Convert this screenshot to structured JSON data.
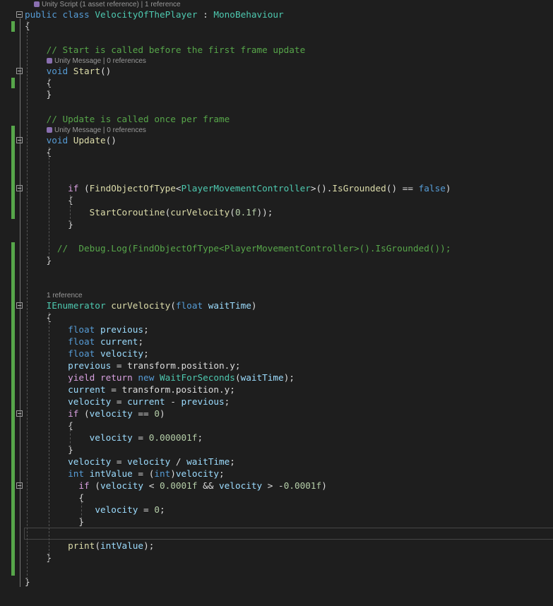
{
  "editor": {
    "colors": {
      "keyword": "#569cd6",
      "type": "#4ec9b0",
      "method": "#dcdcaa",
      "variable": "#9cdcfe",
      "comment": "#57a64a",
      "number": "#b5cea8",
      "control": "#d8a0df",
      "change_bar": "#57a64a"
    },
    "codelens_icon": "unity-cube-icon",
    "lines": [
      {
        "lens": "Unity Script (1 asset reference) | 1 reference",
        "icon": true
      },
      {
        "t": [
          [
            "kw",
            "public"
          ],
          [
            "pl",
            " "
          ],
          [
            "kw",
            "class"
          ],
          [
            "pl",
            " "
          ],
          [
            "ty",
            "VelocityOfThePlayer"
          ],
          [
            "pl",
            " : "
          ],
          [
            "ty",
            "MonoBehaviour"
          ]
        ]
      },
      {
        "t": [
          [
            "pl",
            "{"
          ]
        ]
      },
      {
        "t": []
      },
      {
        "t": [
          [
            "pl",
            "    "
          ],
          [
            "cm",
            "// Start is called before the first frame update"
          ]
        ]
      },
      {
        "lens": "Unity Message | 0 references",
        "icon": true
      },
      {
        "t": [
          [
            "pl",
            "    "
          ],
          [
            "kw",
            "void"
          ],
          [
            "pl",
            " "
          ],
          [
            "fn",
            "Start"
          ],
          [
            "pl",
            "()"
          ]
        ]
      },
      {
        "t": [
          [
            "pl",
            "    {"
          ]
        ]
      },
      {
        "t": [
          [
            "pl",
            "    }"
          ]
        ]
      },
      {
        "t": []
      },
      {
        "t": [
          [
            "pl",
            "    "
          ],
          [
            "cm",
            "// Update is called once per frame"
          ]
        ]
      },
      {
        "lens": "Unity Message | 0 references",
        "icon": true
      },
      {
        "t": [
          [
            "pl",
            "    "
          ],
          [
            "kw",
            "void"
          ],
          [
            "pl",
            " "
          ],
          [
            "fn",
            "Update"
          ],
          [
            "pl",
            "()"
          ]
        ]
      },
      {
        "t": [
          [
            "pl",
            "    {"
          ]
        ]
      },
      {
        "t": []
      },
      {
        "t": []
      },
      {
        "t": [
          [
            "pl",
            "        "
          ],
          [
            "ctl",
            "if"
          ],
          [
            "pl",
            " ("
          ],
          [
            "fn",
            "FindObjectOfType"
          ],
          [
            "pl",
            "<"
          ],
          [
            "ty",
            "PlayerMovementController"
          ],
          [
            "pl",
            ">()."
          ],
          [
            "fn",
            "IsGrounded"
          ],
          [
            "pl",
            "() == "
          ],
          [
            "kw",
            "false"
          ],
          [
            "pl",
            ")"
          ]
        ]
      },
      {
        "t": [
          [
            "pl",
            "        {"
          ]
        ]
      },
      {
        "t": [
          [
            "pl",
            "            "
          ],
          [
            "fn",
            "StartCoroutine"
          ],
          [
            "pl",
            "("
          ],
          [
            "fn",
            "curVelocity"
          ],
          [
            "pl",
            "("
          ],
          [
            "nu",
            "0.1f"
          ],
          [
            "pl",
            "));"
          ]
        ]
      },
      {
        "t": [
          [
            "pl",
            "        }"
          ]
        ]
      },
      {
        "t": []
      },
      {
        "t": [
          [
            "pl",
            "      "
          ],
          [
            "cm",
            "//  Debug.Log(FindObjectOfType<PlayerMovementController>().IsGrounded());"
          ]
        ]
      },
      {
        "t": [
          [
            "pl",
            "    }"
          ]
        ]
      },
      {
        "t": []
      },
      {
        "t": []
      },
      {
        "lens": "1 reference",
        "icon": false
      },
      {
        "t": [
          [
            "pl",
            "    "
          ],
          [
            "ty",
            "IEnumerator"
          ],
          [
            "pl",
            " "
          ],
          [
            "fn",
            "curVelocity"
          ],
          [
            "pl",
            "("
          ],
          [
            "kw",
            "float"
          ],
          [
            "pl",
            " "
          ],
          [
            "va",
            "waitTime"
          ],
          [
            "pl",
            ")"
          ]
        ]
      },
      {
        "t": [
          [
            "pl",
            "    {"
          ]
        ]
      },
      {
        "t": [
          [
            "pl",
            "        "
          ],
          [
            "kw",
            "float"
          ],
          [
            "pl",
            " "
          ],
          [
            "va",
            "previous"
          ],
          [
            "pl",
            ";"
          ]
        ]
      },
      {
        "t": [
          [
            "pl",
            "        "
          ],
          [
            "kw",
            "float"
          ],
          [
            "pl",
            " "
          ],
          [
            "va",
            "current"
          ],
          [
            "pl",
            ";"
          ]
        ]
      },
      {
        "t": [
          [
            "pl",
            "        "
          ],
          [
            "kw",
            "float"
          ],
          [
            "pl",
            " "
          ],
          [
            "va",
            "velocity"
          ],
          [
            "pl",
            ";"
          ]
        ]
      },
      {
        "t": [
          [
            "pl",
            "        "
          ],
          [
            "va",
            "previous"
          ],
          [
            "pl",
            " = transform.position.y;"
          ]
        ]
      },
      {
        "t": [
          [
            "pl",
            "        "
          ],
          [
            "ctl",
            "yield return"
          ],
          [
            "pl",
            " "
          ],
          [
            "kw",
            "new"
          ],
          [
            "pl",
            " "
          ],
          [
            "ty",
            "WaitForSeconds"
          ],
          [
            "pl",
            "("
          ],
          [
            "va",
            "waitTime"
          ],
          [
            "pl",
            ");"
          ]
        ]
      },
      {
        "t": [
          [
            "pl",
            "        "
          ],
          [
            "va",
            "current"
          ],
          [
            "pl",
            " = transform.position.y;"
          ]
        ]
      },
      {
        "t": [
          [
            "pl",
            "        "
          ],
          [
            "va",
            "velocity"
          ],
          [
            "pl",
            " = "
          ],
          [
            "va",
            "current"
          ],
          [
            "pl",
            " - "
          ],
          [
            "va",
            "previous"
          ],
          [
            "pl",
            ";"
          ]
        ]
      },
      {
        "t": [
          [
            "pl",
            "        "
          ],
          [
            "ctl",
            "if"
          ],
          [
            "pl",
            " ("
          ],
          [
            "va",
            "velocity"
          ],
          [
            "pl",
            " == "
          ],
          [
            "nu",
            "0"
          ],
          [
            "pl",
            ")"
          ]
        ]
      },
      {
        "t": [
          [
            "pl",
            "        {"
          ]
        ]
      },
      {
        "t": [
          [
            "pl",
            "            "
          ],
          [
            "va",
            "velocity"
          ],
          [
            "pl",
            " = "
          ],
          [
            "nu",
            "0.000001f"
          ],
          [
            "pl",
            ";"
          ]
        ]
      },
      {
        "t": [
          [
            "pl",
            "        }"
          ]
        ]
      },
      {
        "t": [
          [
            "pl",
            "        "
          ],
          [
            "va",
            "velocity"
          ],
          [
            "pl",
            " = "
          ],
          [
            "va",
            "velocity"
          ],
          [
            "pl",
            " / "
          ],
          [
            "va",
            "waitTime"
          ],
          [
            "pl",
            ";"
          ]
        ]
      },
      {
        "t": [
          [
            "pl",
            "        "
          ],
          [
            "kw",
            "int"
          ],
          [
            "pl",
            " "
          ],
          [
            "va",
            "intValue"
          ],
          [
            "pl",
            " = ("
          ],
          [
            "kw",
            "int"
          ],
          [
            "pl",
            ")"
          ],
          [
            "va",
            "velocity"
          ],
          [
            "pl",
            ";"
          ]
        ]
      },
      {
        "t": [
          [
            "pl",
            "          "
          ],
          [
            "ctl",
            "if"
          ],
          [
            "pl",
            " ("
          ],
          [
            "va",
            "velocity"
          ],
          [
            "pl",
            " < "
          ],
          [
            "nu",
            "0.0001f"
          ],
          [
            "pl",
            " && "
          ],
          [
            "va",
            "velocity"
          ],
          [
            "pl",
            " > -"
          ],
          [
            "nu",
            "0.0001f"
          ],
          [
            "pl",
            ")"
          ]
        ]
      },
      {
        "t": [
          [
            "pl",
            "          {"
          ]
        ]
      },
      {
        "t": [
          [
            "pl",
            "             "
          ],
          [
            "va",
            "velocity"
          ],
          [
            "pl",
            " = "
          ],
          [
            "nu",
            "0"
          ],
          [
            "pl",
            ";"
          ]
        ]
      },
      {
        "t": [
          [
            "pl",
            "          }"
          ]
        ]
      },
      {
        "t": []
      },
      {
        "t": [
          [
            "pl",
            "        "
          ],
          [
            "fn",
            "print"
          ],
          [
            "pl",
            "("
          ],
          [
            "va",
            "intValue"
          ],
          [
            "pl",
            ");"
          ]
        ]
      },
      {
        "t": [
          [
            "pl",
            "    }"
          ]
        ]
      },
      {
        "t": []
      },
      {
        "t": [
          [
            "pl",
            "}"
          ]
        ]
      }
    ]
  }
}
